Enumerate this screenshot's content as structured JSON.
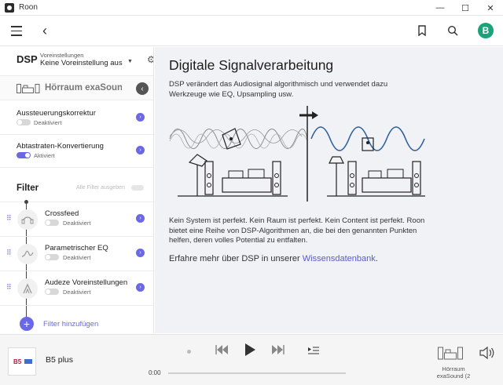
{
  "window": {
    "title": "Roon",
    "minimize": "—",
    "maximize": "☐",
    "close": "✕"
  },
  "topbar": {
    "avatar_letter": "B"
  },
  "dsp": {
    "label": "DSP",
    "preset_caption": "Voreinstellungen",
    "preset_value": "Keine Voreinstellung ausgewählt",
    "zone_name": "Hörraum exaSound"
  },
  "settings": [
    {
      "title": "Aussteuerungskorrektur",
      "state": "Deaktiviert",
      "enabled": false
    },
    {
      "title": "Abtastraten-Konvertierung",
      "state": "Aktiviert",
      "enabled": true
    }
  ],
  "filter": {
    "title": "Filter",
    "hide_all": "Alle Filter ausgeben",
    "items": [
      {
        "name": "Crossfeed",
        "state": "Deaktiviert"
      },
      {
        "name": "Parametrischer EQ",
        "state": "Deaktiviert"
      },
      {
        "name": "Audeze Voreinstellungen",
        "state": "Deaktiviert"
      }
    ],
    "add_label": "Filter hinzufügen"
  },
  "content": {
    "heading": "Digitale Signalverarbeitung",
    "intro": "DSP verändert das Audiosignal algorithmisch und verwendet dazu Werkzeuge wie EQ, Upsampling usw.",
    "body": "Kein System ist perfekt. Kein Raum ist perfekt. Kein Content ist perfekt. Roon bietet eine Reihe von DSP-Algorithmen an, die bei den genannten Punkten helfen, deren volles Potential zu entfalten.",
    "more_prefix": "Erfahre mehr über DSP in unserer ",
    "more_link": "Wissensdatenbank",
    "more_suffix": "."
  },
  "player": {
    "track": "B5 plus",
    "cover_text": "B5",
    "time": "0:00",
    "progress": 0,
    "zone_label": "Hörraum exaSound (2"
  },
  "colors": {
    "accent": "#6b68e8",
    "link": "#5a58d8",
    "avatar": "#1aa37a",
    "wave_processed": "#2f5f9e",
    "content_bg": "#f0f2f5"
  }
}
